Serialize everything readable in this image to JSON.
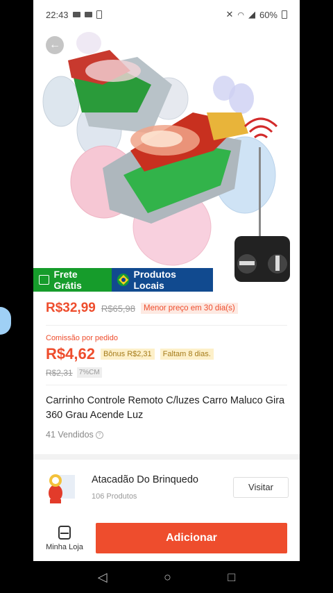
{
  "status_bar": {
    "time": "22:43",
    "battery": "60%"
  },
  "badges": {
    "free_shipping": "Frete Grátis",
    "local": "Produtos Locais"
  },
  "price": {
    "current": "R$32,99",
    "original": "R$65,98",
    "note": "Menor preço em 30 dia(s)"
  },
  "commission": {
    "label": "Comissão por pedido",
    "value": "R$4,62",
    "bonus": "Bônus R$2,31",
    "remaining": "Faltam 8 dias.",
    "old_value": "R$2,31",
    "rate": "7%CM"
  },
  "product": {
    "title": "Carrinho Controle Remoto C/luzes Carro Maluco Gira 360 Grau Acende Luz",
    "sold": "41 Vendidos"
  },
  "shop": {
    "name": "Atacadão Do Brinquedo",
    "count": "106 Produtos",
    "visit_label": "Visitar"
  },
  "bottom": {
    "store_label": "Minha Loja",
    "add_label": "Adicionar"
  },
  "colors": {
    "accent": "#ee4d2d",
    "green_badge": "#169c2b",
    "blue_badge": "#114a8f"
  }
}
